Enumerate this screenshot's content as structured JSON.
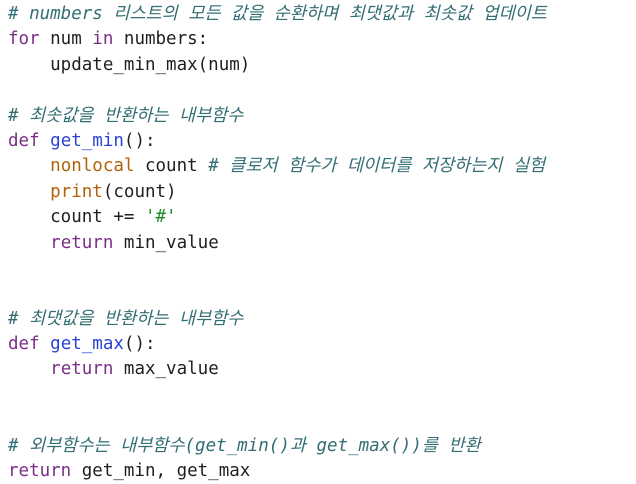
{
  "code": {
    "lines": [
      [
        {
          "t": "# numbers 리스트의 모든 값을 순환하며 최댓값과 최솟값 업데이트",
          "k": "comment"
        }
      ],
      [
        {
          "t": "for",
          "k": "keyword"
        },
        {
          "t": " num ",
          "k": "plain"
        },
        {
          "t": "in",
          "k": "keyword"
        },
        {
          "t": " numbers:",
          "k": "plain"
        }
      ],
      [
        {
          "t": "    update_min_max(num)",
          "k": "plain"
        }
      ],
      [],
      [
        {
          "t": "# 최솟값을 반환하는 내부함수",
          "k": "comment"
        }
      ],
      [
        {
          "t": "def",
          "k": "keyword"
        },
        {
          "t": " ",
          "k": "plain"
        },
        {
          "t": "get_min",
          "k": "def"
        },
        {
          "t": "():",
          "k": "plain"
        }
      ],
      [
        {
          "t": "    ",
          "k": "plain"
        },
        {
          "t": "nonlocal",
          "k": "builtin"
        },
        {
          "t": " count ",
          "k": "plain"
        },
        {
          "t": "# 클로저 함수가 데이터를 저장하는지 실험",
          "k": "comment"
        }
      ],
      [
        {
          "t": "    ",
          "k": "plain"
        },
        {
          "t": "print",
          "k": "builtin"
        },
        {
          "t": "(count)",
          "k": "plain"
        }
      ],
      [
        {
          "t": "    count += ",
          "k": "plain"
        },
        {
          "t": "'#'",
          "k": "string"
        }
      ],
      [
        {
          "t": "    ",
          "k": "plain"
        },
        {
          "t": "return",
          "k": "keyword"
        },
        {
          "t": " min_value",
          "k": "plain"
        }
      ],
      [],
      [],
      [
        {
          "t": "# 최댓값을 반환하는 내부함수",
          "k": "comment"
        }
      ],
      [
        {
          "t": "def",
          "k": "keyword"
        },
        {
          "t": " ",
          "k": "plain"
        },
        {
          "t": "get_max",
          "k": "def"
        },
        {
          "t": "():",
          "k": "plain"
        }
      ],
      [
        {
          "t": "    ",
          "k": "plain"
        },
        {
          "t": "return",
          "k": "keyword"
        },
        {
          "t": " max_value",
          "k": "plain"
        }
      ],
      [],
      [],
      [
        {
          "t": "# 외부함수는 내부함수(get_min()과 get_max())를 반환",
          "k": "comment"
        }
      ],
      [
        {
          "t": "return",
          "k": "keyword"
        },
        {
          "t": " get_min, get_max",
          "k": "plain"
        }
      ]
    ]
  }
}
